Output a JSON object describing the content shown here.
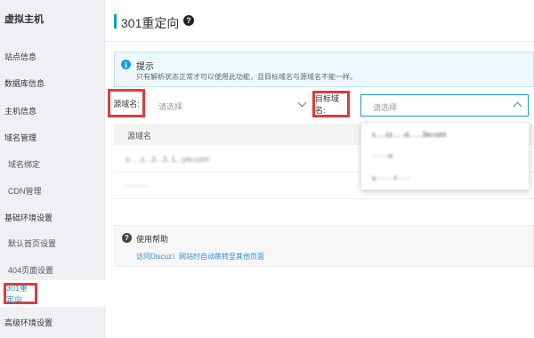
{
  "sidebar": {
    "title": "虚拟主机",
    "items": [
      {
        "label": "站点信息"
      },
      {
        "label": "数据库信息"
      },
      {
        "label": "主机信息"
      },
      {
        "label": "域名管理"
      },
      {
        "label": "域名绑定"
      },
      {
        "label": "CDN管理"
      },
      {
        "label": "基础环境设置"
      },
      {
        "label": "默认首页设置"
      },
      {
        "label": "404页面设置"
      },
      {
        "label": "301重定向"
      },
      {
        "label": "高级环境设置"
      }
    ]
  },
  "header": {
    "title": "301重定向",
    "help_glyph": "?"
  },
  "tip": {
    "icon_glyph": "i",
    "title": "提示",
    "text": "只有解析状态正常才可以使用此功能，且目标域名与源域名不能一样。"
  },
  "form": {
    "source_label": "源域名:",
    "source_placeholder": "请选择",
    "target_label": "目标域名:",
    "target_placeholder": "请选择"
  },
  "table": {
    "header": "源域名",
    "rows": [
      "x.....z...3...3..1...yw.com",
      "·········"
    ]
  },
  "dropdown": {
    "options": [
      "x.....zz......d.......3w.com",
      "·······n",
      "v········l······"
    ]
  },
  "help": {
    "icon_glyph": "?",
    "title": "使用帮助",
    "link": "访问Discuz！网站时自动跳转至其他页面"
  },
  "colors": {
    "accent": "#1b9ad6",
    "highlight_border": "#e23a3a",
    "link": "#2d8ecf"
  }
}
